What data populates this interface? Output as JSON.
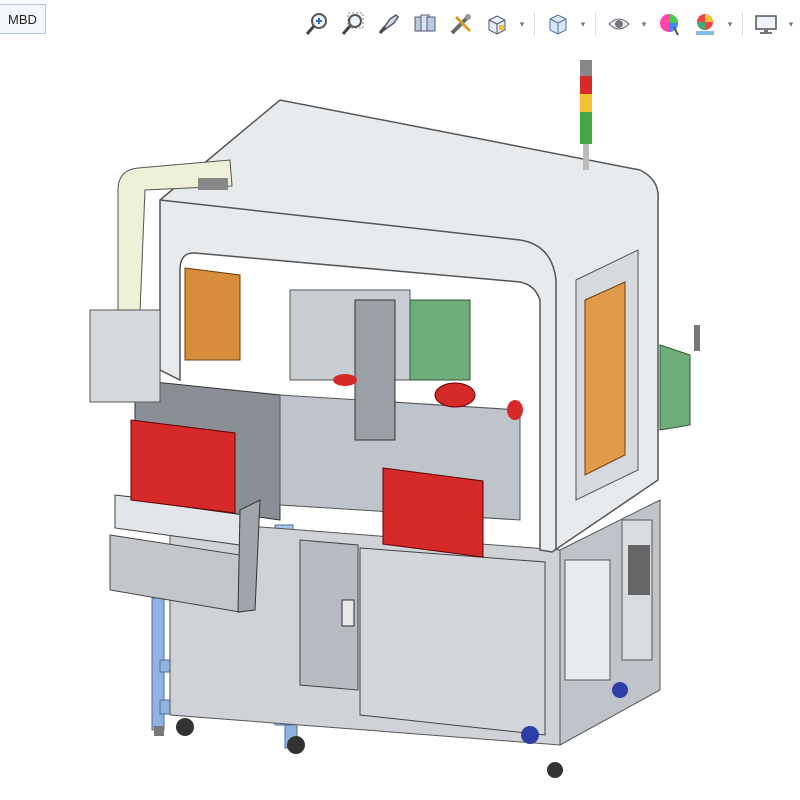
{
  "tab": {
    "label": "MBD"
  },
  "toolbar": {
    "buttons": [
      {
        "icon": "zoom-in-icon"
      },
      {
        "icon": "zoom-area-icon"
      },
      {
        "icon": "pan-icon"
      },
      {
        "icon": "saved-views-icon"
      },
      {
        "icon": "measure-icon"
      },
      {
        "icon": "display-style-icon",
        "dropdown": true
      },
      {
        "icon": "orient-cube-icon",
        "dropdown": true
      },
      {
        "icon": "visibility-eye-icon",
        "dropdown": true
      },
      {
        "icon": "appearance-color-icon"
      },
      {
        "icon": "scene-render-icon",
        "dropdown": true
      },
      {
        "icon": "monitor-display-icon",
        "dropdown": true
      }
    ]
  },
  "colors": {
    "accent_red": "#d62a2a",
    "frame_gray": "#dfe3e8",
    "window_orange": "#e09a4a",
    "blue_frame": "#8fb4e0",
    "green_parts": "#6fae7a"
  }
}
